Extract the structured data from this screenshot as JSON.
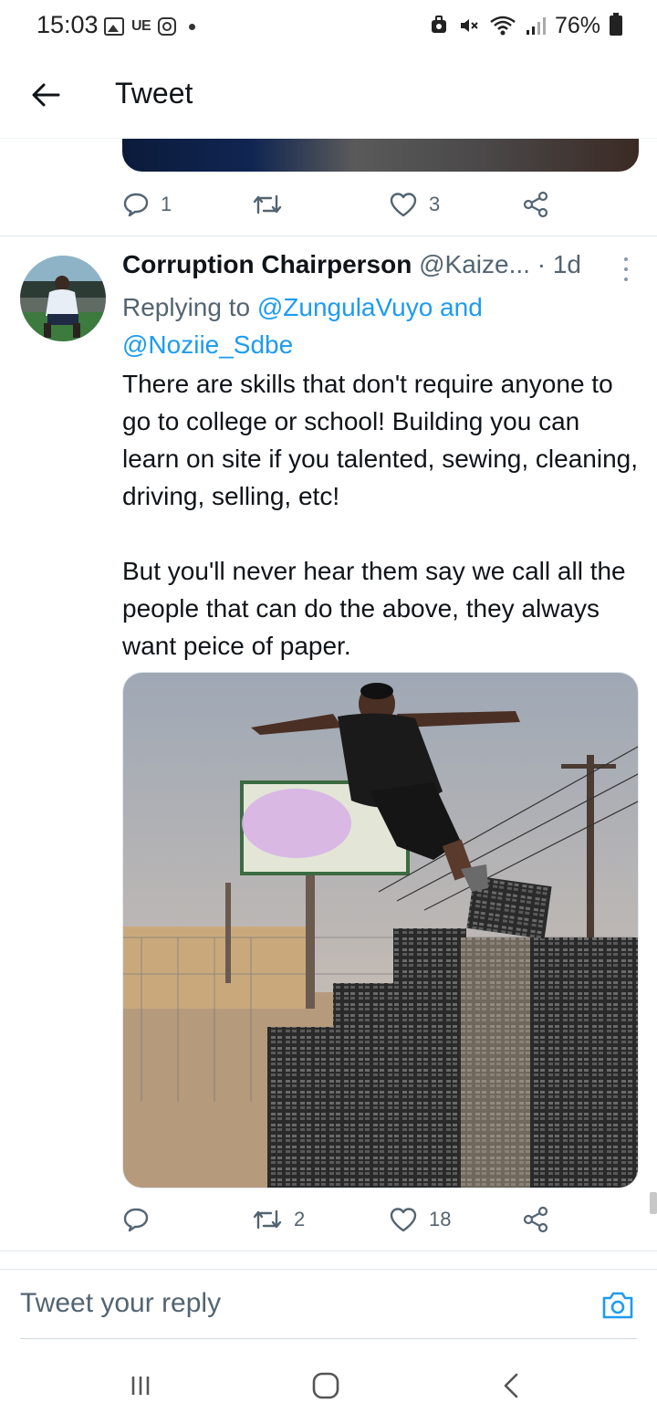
{
  "status_bar": {
    "time": "15:03",
    "notification_icons": [
      "image-icon",
      "ue-icon",
      "instagram-icon",
      "dot-icon"
    ],
    "ue_label": "UE",
    "system_icons": [
      "alarm-icon",
      "mute-icon",
      "wifi-icon",
      "signal-icon"
    ],
    "battery": "76%"
  },
  "header": {
    "title": "Tweet",
    "back_icon": "arrow-left-icon"
  },
  "previous_tweet": {
    "actions": {
      "reply_count": "1",
      "retweet_count": "",
      "like_count": "3"
    }
  },
  "tweet": {
    "author_name": "Corruption Chairperson",
    "author_handle": "@Kaize...",
    "time": "· 1d",
    "replying_prefix": "Replying to",
    "replying_user_1": "@ZungulaVuyo",
    "replying_and": "and",
    "replying_user_2": "@Noziie_Sdbe",
    "paragraphs": [
      "There are skills that don't require anyone to go to college or school! Building you can learn on site if you talented, sewing, cleaning, driving, selling, etc!",
      "But you'll never hear them say we call all the people that can do the above, they always want peice of paper."
    ],
    "actions": {
      "reply_count": "",
      "retweet_count": "2",
      "like_count": "18"
    }
  },
  "composer": {
    "placeholder": "Tweet your reply",
    "camera_icon": "camera-icon"
  },
  "nav_bar": {
    "icons": [
      "recent-apps-icon",
      "home-icon",
      "back-icon"
    ]
  },
  "colors": {
    "accent": "#1d9bf0",
    "text_primary": "#0f1419",
    "text_secondary": "#536471",
    "divider": "#e1e8ed"
  }
}
